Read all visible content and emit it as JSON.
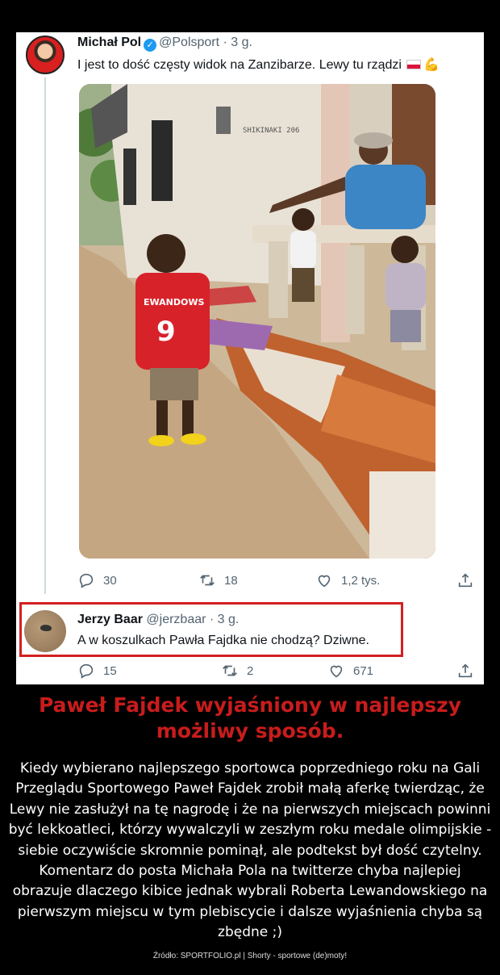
{
  "tweet": {
    "author_name": "Michał Pol",
    "handle_time": "@Polsport · 3 g.",
    "text": "I jest to dość częsty widok na Zanzibarze. Lewy tu rządzi",
    "photo_shirt_name": "EWANDOWS",
    "photo_shirt_number": "9",
    "photo_wall_text": "SHIKINAKI 206",
    "replies": "30",
    "retweets": "18",
    "likes": "1,2 tys."
  },
  "reply": {
    "author_name": "Jerzy Baar",
    "handle_time": "@jerzbaar · 3 g.",
    "text": "A w koszulkach Pawła Fajdka nie chodzą? Dziwne.",
    "replies": "15",
    "retweets": "2",
    "likes": "671"
  },
  "caption": {
    "headline_line1": "Paweł Fajdek wyjaśniony w najlepszy",
    "headline_line2": "możliwy sposób.",
    "body": "Kiedy wybierano najlepszego sportowca poprzedniego roku na Gali Przeglądu Sportowego Paweł Fajdek zrobił małą aferkę twierdząc, że Lewy nie zasłużył na tę nagrodę i że na pierwszych miejscach powinni być lekkoatleci, którzy wywalczyli w zeszłym roku medale olimpijskie - siebie oczywiście skromnie pominął, ale podtekst był dość czytelny. Komentarz do posta Michała Pola na twitterze chyba najlepiej obrazuje dlaczego kibice jednak wybrali Roberta Lewandowskiego na pierwszym miejscu w tym plebiscycie i dalsze wyjaśnienia chyba są zbędne ;)",
    "source": "Źródło: SPORTFOLIO.pl | Shorty - sportowe (de)moty!"
  },
  "colors": {
    "headline": "#c81c1c",
    "highlight_box": "#d32020",
    "verified": "#1d9bf0",
    "muted": "#536471"
  },
  "icons": [
    "reply-icon",
    "retweet-icon",
    "like-icon",
    "share-icon",
    "verified-icon",
    "poland-flag-icon",
    "flexed-biceps-icon"
  ]
}
